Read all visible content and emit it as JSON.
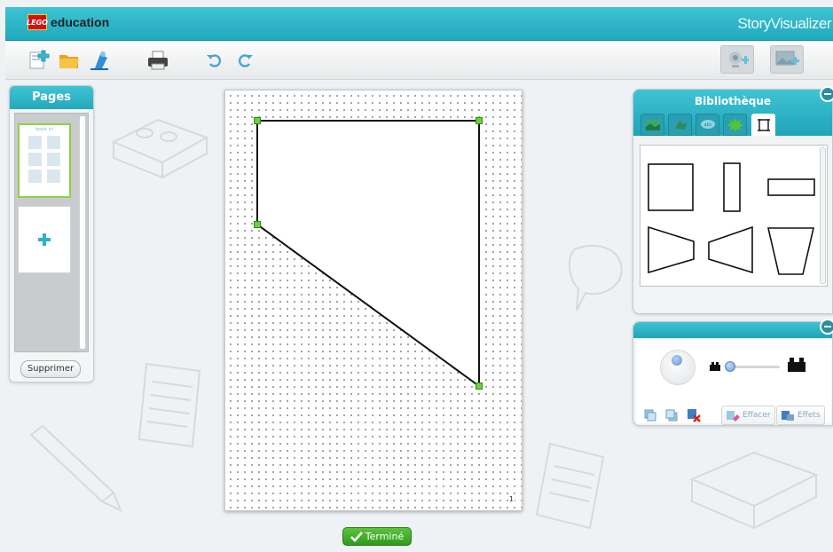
{
  "app": {
    "brand": "education",
    "lego_badge": "LEGO",
    "title": "StoryVisualizer"
  },
  "toolbar": {
    "buttons": [
      "new-page-icon",
      "open-folder-icon",
      "export-icon",
      "print-icon",
      "undo-icon",
      "redo-icon"
    ],
    "right_buttons": [
      "webcam-icon",
      "add-image-icon"
    ]
  },
  "pages": {
    "title": "Pages",
    "thumb_caption": "texte ici",
    "delete_label": "Supprimer"
  },
  "canvas": {
    "page_number": "1"
  },
  "done_label": "Terminé",
  "library": {
    "title": "Bibliothèque",
    "tabs": [
      "background-icon",
      "object-icon",
      "speech-bubble-icon",
      "effect-burst-icon",
      "shape-icon"
    ],
    "shapes": [
      "square-shape",
      "tall-rectangle-shape",
      "wide-rectangle-shape",
      "trapezoid-right-shape",
      "trapezoid-left-shape",
      "trapezoid-down-shape"
    ]
  },
  "properties": {
    "erase_label": "Effacer",
    "effects_label": "Effets"
  },
  "colors": {
    "accent": "#2ab4c6",
    "done": "#3aa827",
    "select_handle": "#6cd13b"
  }
}
